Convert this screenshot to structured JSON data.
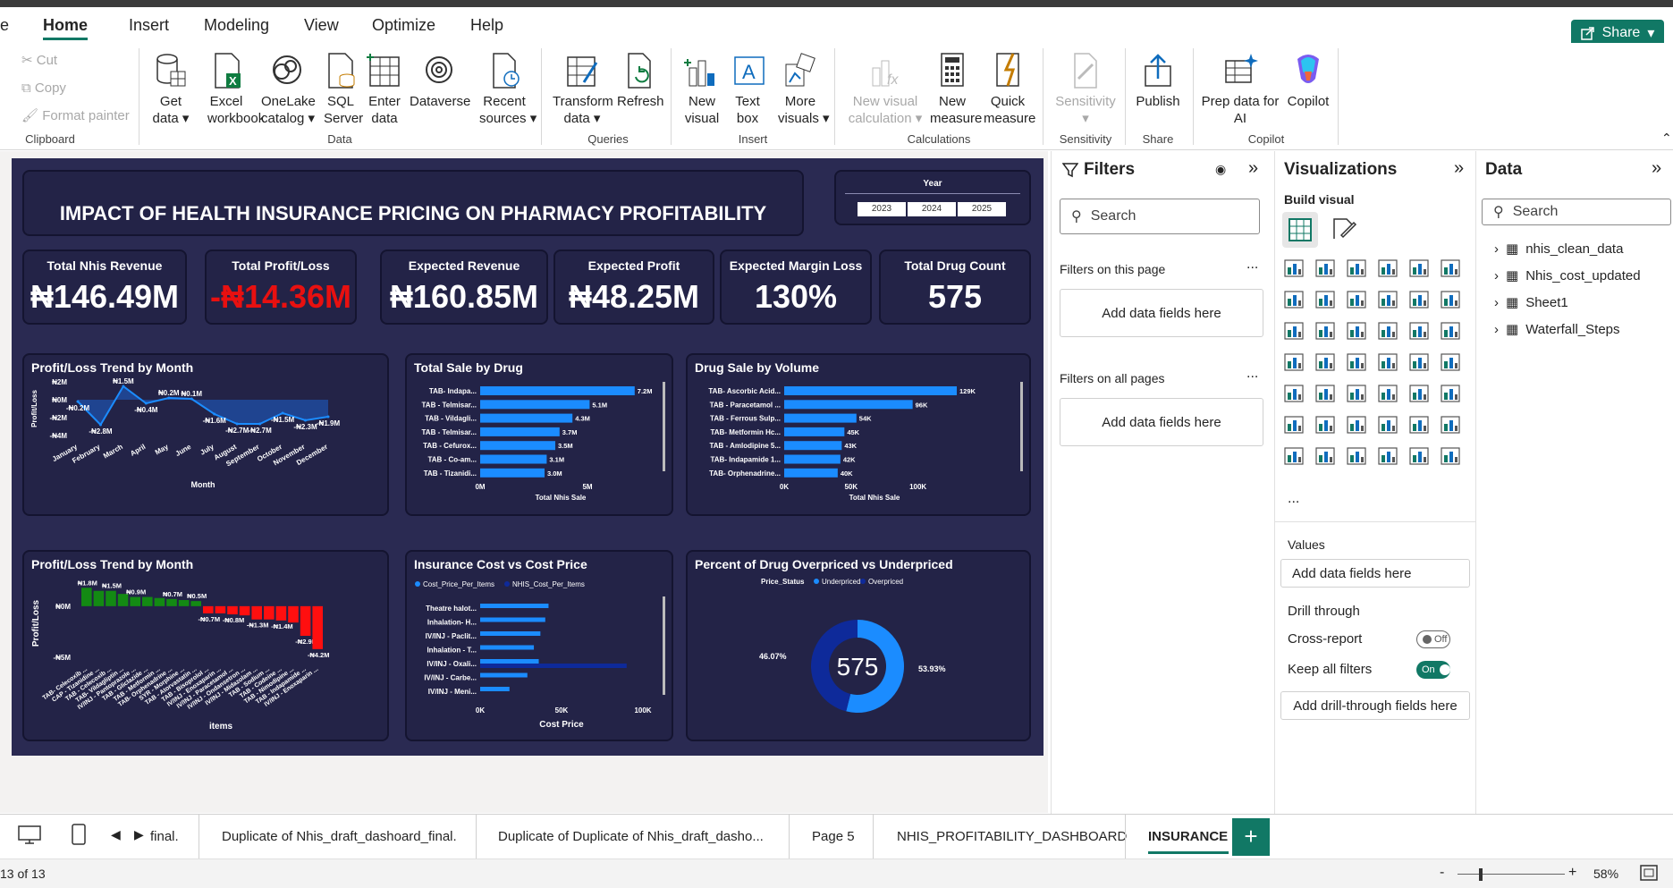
{
  "menu": {
    "file_stub": "e",
    "items": [
      "Home",
      "Insert",
      "Modeling",
      "View",
      "Optimize",
      "Help"
    ],
    "share": "Share"
  },
  "ribbon": {
    "clipboard": {
      "cut": "Cut",
      "copy": "Copy",
      "format_painter": "Format painter",
      "label": "Clipboard"
    },
    "data": {
      "items": [
        {
          "l1": "Get",
          "l2": "data ▾"
        },
        {
          "l1": "Excel",
          "l2": "workbook"
        },
        {
          "l1": "OneLake",
          "l2": "catalog ▾"
        },
        {
          "l1": "SQL",
          "l2": "Server"
        },
        {
          "l1": "Enter",
          "l2": "data"
        },
        {
          "l1": "Dataverse",
          "l2": ""
        },
        {
          "l1": "Recent",
          "l2": "sources ▾"
        }
      ],
      "label": "Data"
    },
    "queries": {
      "items": [
        {
          "l1": "Transform",
          "l2": "data ▾"
        },
        {
          "l1": "Refresh",
          "l2": ""
        }
      ],
      "label": "Queries"
    },
    "insert": {
      "items": [
        {
          "l1": "New",
          "l2": "visual"
        },
        {
          "l1": "Text",
          "l2": "box"
        },
        {
          "l1": "More",
          "l2": "visuals ▾"
        }
      ],
      "label": "Insert"
    },
    "calculations": {
      "items": [
        {
          "l1": "New visual",
          "l2": "calculation ▾"
        },
        {
          "l1": "New",
          "l2": "measure"
        },
        {
          "l1": "Quick",
          "l2": "measure"
        }
      ],
      "label": "Calculations"
    },
    "sensitivity": {
      "items": [
        {
          "l1": "Sensitivity",
          "l2": "▾"
        }
      ],
      "label": "Sensitivity"
    },
    "share": {
      "items": [
        {
          "l1": "Publish",
          "l2": ""
        }
      ],
      "label": "Share"
    },
    "copilot": {
      "items": [
        {
          "l1": "Prep data for",
          "l2": "AI"
        },
        {
          "l1": "Copilot",
          "l2": ""
        }
      ],
      "label": "Copilot"
    }
  },
  "report": {
    "title": "IMPACT OF HEALTH INSURANCE PRICING ON PHARMACY PROFITABILITY",
    "year_slicer": {
      "label": "Year",
      "options": [
        "2023",
        "2024",
        "2025"
      ]
    },
    "kpis": [
      {
        "label": "Total Nhis Revenue",
        "value": "₦146.49M",
        "color": "#ffffff"
      },
      {
        "label": "Total Profit/Loss",
        "value": "-₦14.36M",
        "color": "#e81010"
      },
      {
        "label": "Expected Revenue",
        "value": "₦160.85M",
        "color": "#ffffff"
      },
      {
        "label": "Expected Profit",
        "value": "₦48.25M",
        "color": "#ffffff"
      },
      {
        "label": "Expected Margin Loss",
        "value": "130%",
        "color": "#ffffff"
      },
      {
        "label": "Total Drug Count",
        "value": "575",
        "color": "#ffffff"
      }
    ]
  },
  "chart_data": [
    {
      "type": "area",
      "title": "Profit/Loss Trend by Month",
      "xlabel": "Month",
      "ylabel": "Profit/Loss",
      "categories": [
        "January",
        "February",
        "March",
        "April",
        "May",
        "June",
        "July",
        "August",
        "September",
        "October",
        "November",
        "December"
      ],
      "values": [
        -0.2,
        -2.8,
        1.5,
        -0.4,
        0.2,
        0.1,
        -1.6,
        -2.7,
        -2.7,
        -1.5,
        -2.3,
        -1.9
      ],
      "data_labels": [
        "-₦0.2M",
        "-₦2.8M",
        "₦1.5M",
        "-₦0.4M",
        "₦0.2M",
        "₦0.1M",
        "-₦1.6M",
        "-₦2.7M",
        "-₦2.7M",
        "-₦1.5M",
        "-₦2.3M",
        "-₦1.9M"
      ],
      "yticks": [
        "₦2M",
        "₦0M",
        "-₦2M",
        "-₦4M"
      ],
      "ylim": [
        -4,
        2
      ]
    },
    {
      "type": "bar",
      "title": "Total Sale by Drug",
      "xlabel": "Total Nhis Sale",
      "categories": [
        "TAB- Indapa...",
        "TAB - Telmisar...",
        "TAB - Vildagli...",
        "TAB - Telmisar...",
        "TAB - Cefurox...",
        "TAB - Co-am...",
        "TAB - Tizanidi..."
      ],
      "values": [
        7.2,
        5.1,
        4.3,
        3.7,
        3.5,
        3.1,
        3.0
      ],
      "data_labels": [
        "7.2M",
        "5.1M",
        "4.3M",
        "3.7M",
        "3.5M",
        "3.1M",
        "3.0M"
      ],
      "xticks": [
        "0M",
        "5M"
      ],
      "xlim": [
        0,
        7.5
      ]
    },
    {
      "type": "bar",
      "title": "Drug Sale by Volume",
      "xlabel": "Total Nhis Sale",
      "categories": [
        "TAB- Ascorbic Acid...",
        "TAB - Paracetamol ...",
        "TAB - Ferrous Sulp...",
        "TAB- Metformin Hc...",
        "TAB - Amlodipine 5...",
        "TAB- Indapamide 1...",
        "TAB- Orphenadrine..."
      ],
      "values": [
        129,
        96,
        54,
        45,
        43,
        42,
        40
      ],
      "data_labels": [
        "129K",
        "96K",
        "54K",
        "45K",
        "43K",
        "42K",
        "40K"
      ],
      "xticks": [
        "0K",
        "50K",
        "100K"
      ],
      "xlim": [
        0,
        135
      ]
    },
    {
      "type": "bar",
      "title": "Profit/Loss Trend by Month",
      "xlabel": "items",
      "ylabel": "Profit/Loss",
      "categories": [
        "TAB- Celecoxib ...",
        "CAP - Tizanidine ...",
        "TAB - Celecoxib ...",
        "TAB- Vildagliptin ...",
        "IV/INJ - Pantoprazole ...",
        "TAB - Gliclazide ...",
        "TAB - Metformin ...",
        "TAB- Orphenadrine ...",
        "SYR - Morphine ...",
        "TAB - Atorvastatin ...",
        "TAB - Bisoprolol ...",
        "IV/INJ - Enoxaparin ...",
        "IV/INJ - Paracetamol ...",
        "IV/INJ - Ondansetron ...",
        "IV/INJ - Midazolam ...",
        "TAB - Sodium ...",
        "TAB - Codeine ...",
        "TAB - Nimodipine ...",
        "TAB - Indapamide ...",
        "IV/INJ - Enoxaparin ..."
      ],
      "values": [
        1.8,
        1.5,
        1.5,
        1.2,
        0.9,
        0.9,
        0.8,
        0.7,
        0.6,
        0.5,
        -0.7,
        -0.7,
        -0.8,
        -0.9,
        -1.3,
        -1.3,
        -1.4,
        -1.6,
        -2.9,
        -4.2
      ],
      "data_labels": [
        "₦1.8M",
        "",
        "₦1.5M",
        "",
        "₦0.9M",
        "",
        "",
        "₦0.7M",
        "",
        "₦0.5M",
        "-₦0.7M",
        "",
        "-₦0.8M",
        "",
        "-₦1.3M",
        "",
        "-₦1.4M",
        "",
        "-₦2.9M",
        "-₦4.2M"
      ],
      "yticks": [
        "₦0M",
        "-₦5M"
      ],
      "ylim": [
        -5,
        2
      ]
    },
    {
      "type": "bar",
      "title": "Insurance Cost vs Cost Price",
      "xlabel": "Cost Price",
      "legend": [
        "Cost_Price_Per_Items",
        "NHIS_Cost_Per_Items"
      ],
      "categories": [
        "Theatre halot...",
        "Inhalation- H...",
        "IV/INJ - Paclit...",
        "Inhalation - T...",
        "IV/INJ - Oxali...",
        "IV/INJ - Carbe...",
        "IV/INJ - Meni..."
      ],
      "series": [
        {
          "name": "Cost_Price_Per_Items",
          "values": [
            42,
            40,
            37,
            33,
            36,
            29,
            18
          ]
        },
        {
          "name": "NHIS_Cost_Per_Items",
          "values": [
            0,
            0,
            0,
            0,
            90,
            0,
            0
          ]
        }
      ],
      "xticks": [
        "0K",
        "50K",
        "100K"
      ],
      "xlim": [
        0,
        100
      ]
    },
    {
      "type": "pie",
      "title": "Percent of Drug Overpriced vs Underpriced",
      "legend_title": "Price_Status",
      "labels": [
        "Underpriced",
        "Overpriced"
      ],
      "values": [
        53.93,
        46.07
      ],
      "data_labels": [
        "53.93%",
        "46.07%"
      ],
      "center_label": "575"
    }
  ],
  "filters": {
    "title": "Filters",
    "search": "Search",
    "on_page": "Filters on this page",
    "all_pages": "Filters on all pages",
    "add": "Add data fields here",
    "more": "..."
  },
  "viz": {
    "title": "Visualizations",
    "build": "Build visual",
    "values": "Values",
    "add_values": "Add data fields here",
    "drill": "Drill through",
    "cross": "Cross-report",
    "cross_state": "Off",
    "keep": "Keep all filters",
    "keep_state": "On",
    "add_drill": "Add drill-through fields here",
    "more": "..."
  },
  "data_pane": {
    "title": "Data",
    "search": "Search",
    "tables": [
      "nhis_clean_data",
      "Nhis_cost_updated",
      "Sheet1",
      "Waterfall_Steps"
    ]
  },
  "tabs": [
    "final.",
    "Duplicate of Nhis_draft_dashoard_final.",
    "Duplicate of Duplicate of Nhis_draft_dasho...",
    "Page 5",
    "NHIS_PROFITABILITY_DASHBOARD",
    "INSURANCE P"
  ],
  "status": {
    "page": "13 of 13",
    "zoom": "58%"
  }
}
